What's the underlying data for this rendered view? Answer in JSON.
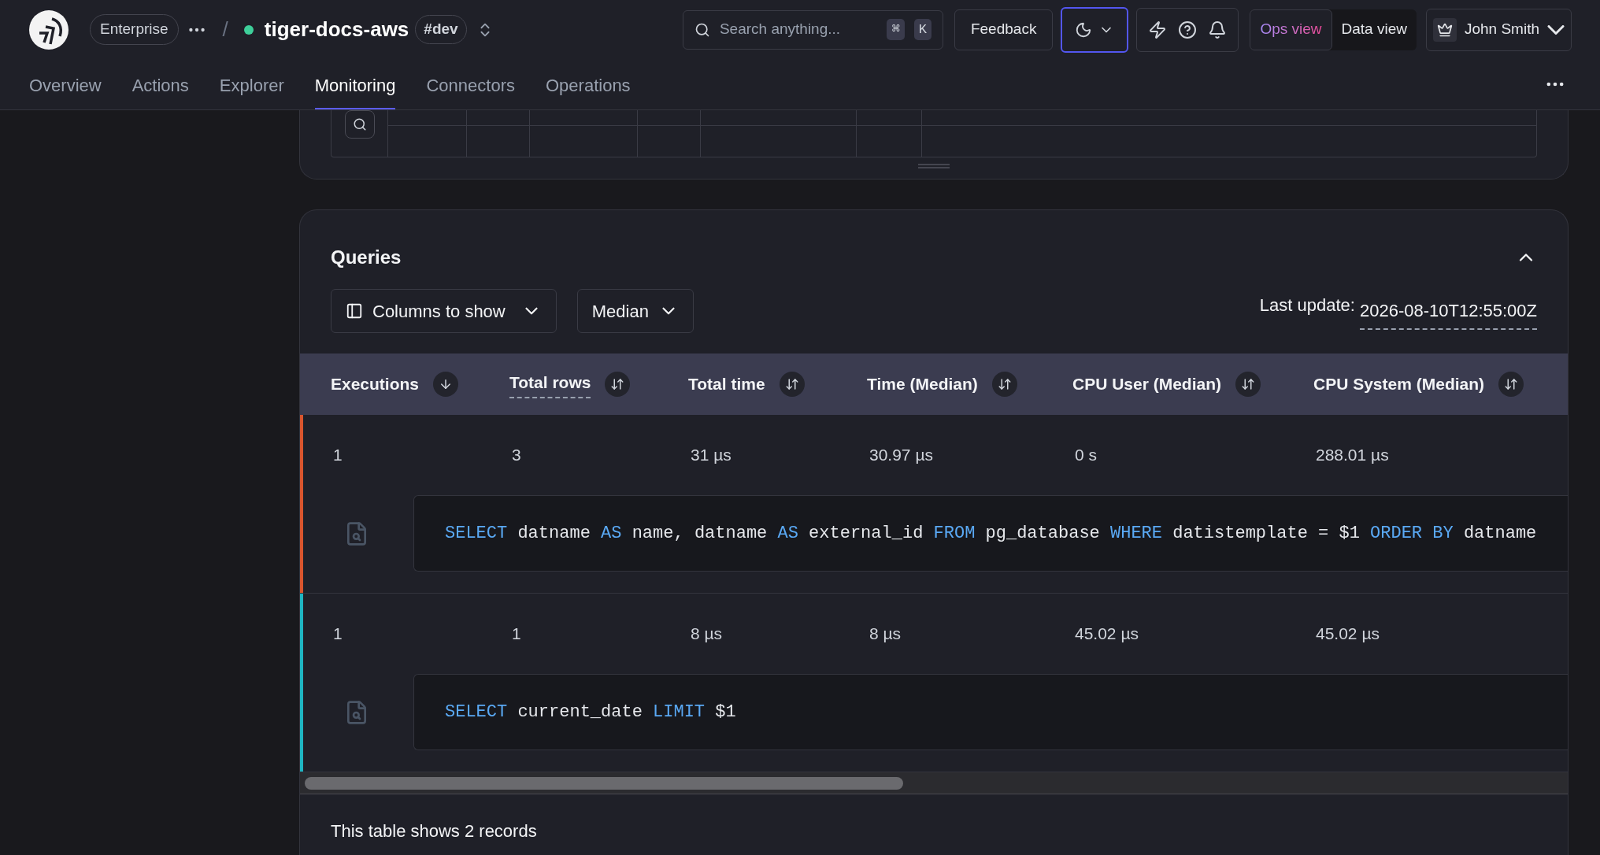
{
  "header": {
    "org": "Enterprise",
    "separator": "/",
    "project": "tiger-docs-aws",
    "branch": "#dev",
    "search": {
      "placeholder": "Search anything...",
      "shortcut": [
        "⌘",
        "K"
      ]
    },
    "feedback": "Feedback",
    "views": [
      {
        "label": "Ops view",
        "selected": true
      },
      {
        "label": "Data view",
        "selected": false
      }
    ],
    "user": "John Smith"
  },
  "tabs": [
    {
      "label": "Overview",
      "selected": false
    },
    {
      "label": "Actions",
      "selected": false
    },
    {
      "label": "Explorer",
      "selected": false
    },
    {
      "label": "Monitoring",
      "selected": true
    },
    {
      "label": "Connectors",
      "selected": false
    },
    {
      "label": "Operations",
      "selected": false
    }
  ],
  "queries": {
    "title": "Queries",
    "expanded": true,
    "columns_button": "Columns to show",
    "aggregate": "Median",
    "last_update_label": "Last update:",
    "last_update": "2026-08-10T12:55:00Z",
    "columns": [
      {
        "label": "Executions",
        "sorted": true,
        "underlined": false
      },
      {
        "label": "Total rows",
        "sorted": false,
        "underlined": true
      },
      {
        "label": "Total time",
        "sorted": false,
        "underlined": false
      },
      {
        "label": "Time (Median)",
        "sorted": false,
        "underlined": false
      },
      {
        "label": "CPU User (Median)",
        "sorted": false,
        "underlined": false
      },
      {
        "label": "CPU System (Median)",
        "sorted": false,
        "underlined": false
      }
    ],
    "rows": [
      {
        "color": "#d9552e",
        "cells": [
          "1",
          "3",
          "31 µs",
          "30.97 µs",
          "0 s",
          "288.01 µs"
        ],
        "sql": [
          {
            "kind": "keyword",
            "text": "SELECT"
          },
          {
            "kind": "plain",
            "text": "datname"
          },
          {
            "kind": "keyword",
            "text": "AS"
          },
          {
            "kind": "plain",
            "text": "name,"
          },
          {
            "kind": "plain",
            "text": "datname"
          },
          {
            "kind": "keyword",
            "text": "AS"
          },
          {
            "kind": "plain",
            "text": "external_id"
          },
          {
            "kind": "keyword",
            "text": "FROM"
          },
          {
            "kind": "plain",
            "text": "pg_database"
          },
          {
            "kind": "keyword",
            "text": "WHERE"
          },
          {
            "kind": "plain",
            "text": "datistemplate = $1"
          },
          {
            "kind": "keyword",
            "text": "ORDER BY"
          },
          {
            "kind": "plain",
            "text": "datname"
          }
        ]
      },
      {
        "color": "#1fb5c2",
        "cells": [
          "1",
          "1",
          "8 µs",
          "8 µs",
          "45.02 µs",
          "45.02 µs"
        ],
        "sql": [
          {
            "kind": "keyword",
            "text": "SELECT"
          },
          {
            "kind": "plain",
            "text": "current_date"
          },
          {
            "kind": "keyword",
            "text": "LIMIT"
          },
          {
            "kind": "plain",
            "text": "$1"
          }
        ]
      }
    ],
    "footer": "This table shows 2 records"
  }
}
